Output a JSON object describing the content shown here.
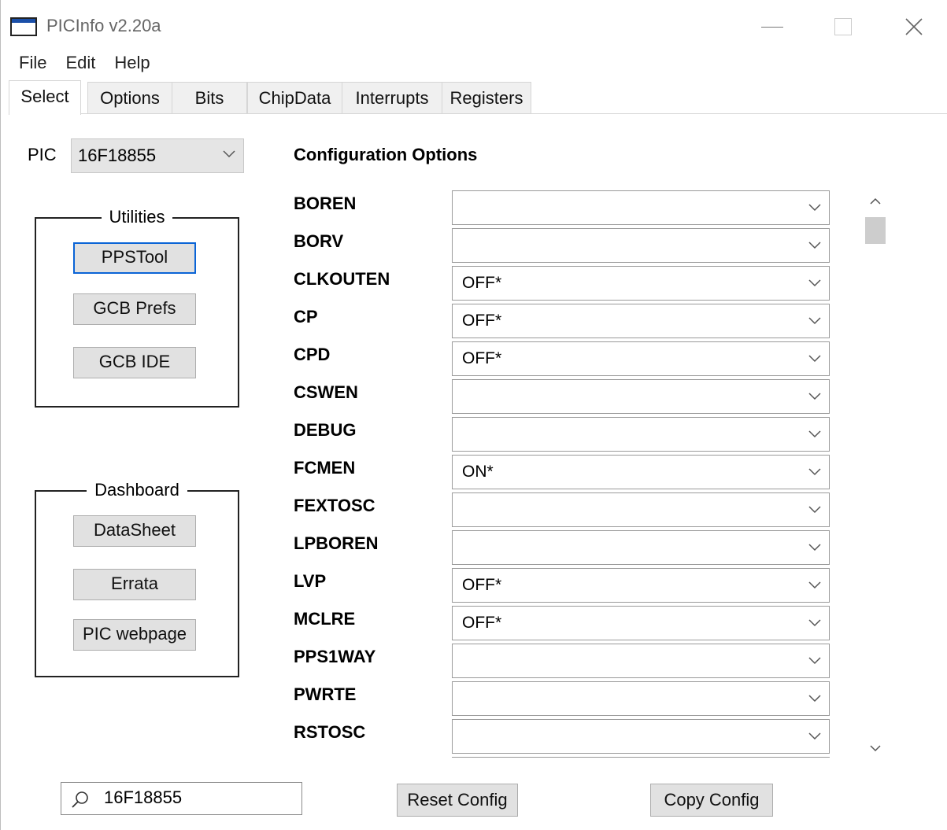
{
  "window": {
    "title": "PICInfo v2.20a"
  },
  "menu": [
    "File",
    "Edit",
    "Help"
  ],
  "tabs": [
    "Select",
    "Options",
    "Bits",
    "ChipData",
    "Interrupts",
    "Registers"
  ],
  "active_tab": "Select",
  "pic": {
    "label": "PIC",
    "selected": "16F18855"
  },
  "utilities": {
    "legend": "Utilities",
    "buttons": [
      "PPSTool",
      "GCB Prefs",
      "GCB IDE"
    ]
  },
  "dashboard": {
    "legend": "Dashboard",
    "buttons": [
      "DataSheet",
      "Errata",
      "PIC webpage"
    ]
  },
  "config": {
    "title": "Configuration Options",
    "rows": [
      {
        "name": "BOREN",
        "value": ""
      },
      {
        "name": "BORV",
        "value": ""
      },
      {
        "name": "CLKOUTEN",
        "value": "OFF*"
      },
      {
        "name": "CP",
        "value": "OFF*"
      },
      {
        "name": "CPD",
        "value": "OFF*"
      },
      {
        "name": "CSWEN",
        "value": ""
      },
      {
        "name": "DEBUG",
        "value": ""
      },
      {
        "name": "FCMEN",
        "value": "ON*"
      },
      {
        "name": "FEXTOSC",
        "value": ""
      },
      {
        "name": "LPBOREN",
        "value": ""
      },
      {
        "name": "LVP",
        "value": "OFF*"
      },
      {
        "name": "MCLRE",
        "value": "OFF*"
      },
      {
        "name": "PPS1WAY",
        "value": ""
      },
      {
        "name": "PWRTE",
        "value": ""
      },
      {
        "name": "RSTOSC",
        "value": ""
      }
    ]
  },
  "bottom": {
    "search_value": "16F18855",
    "reset_label": "Reset Config",
    "copy_label": "Copy Config"
  }
}
